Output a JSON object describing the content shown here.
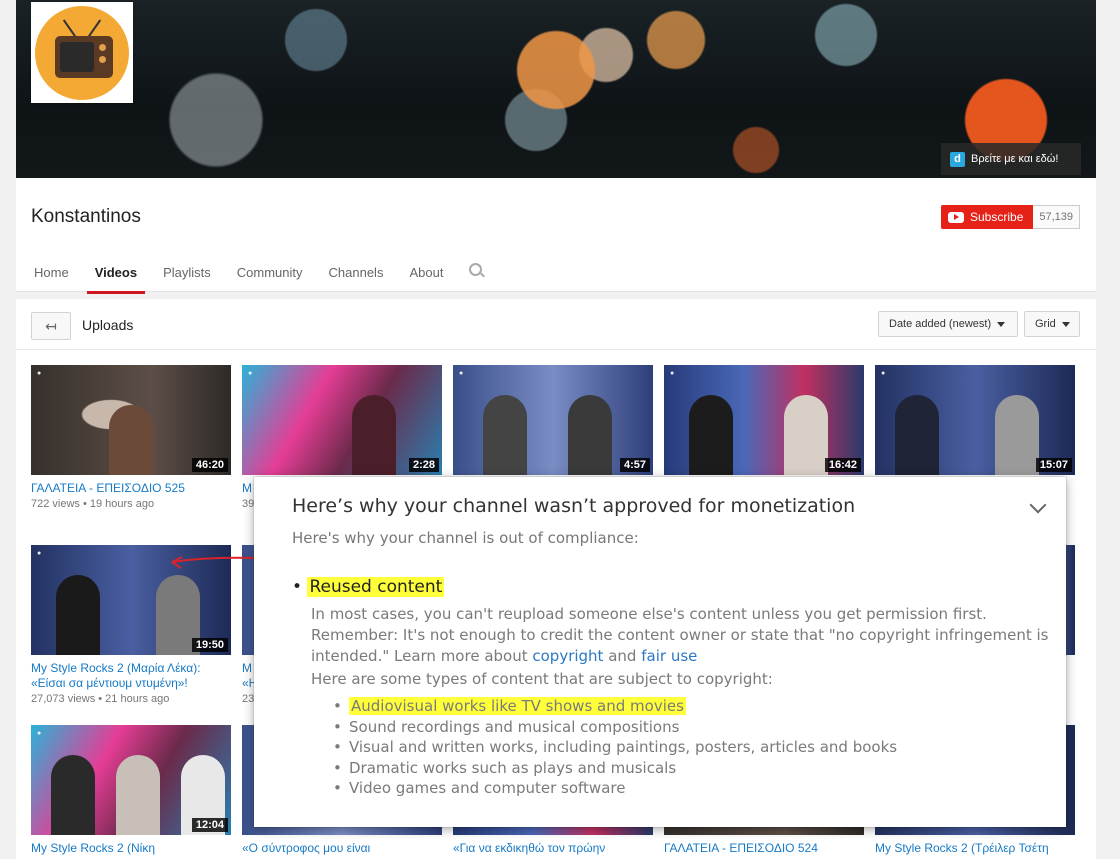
{
  "channel": {
    "name": "Konstantinos",
    "promo_text": "Βρείτε με και εδώ!",
    "subscribe_label": "Subscribe",
    "subscriber_count": "57,139"
  },
  "tabs": [
    "Home",
    "Videos",
    "Playlists",
    "Community",
    "Channels",
    "About"
  ],
  "active_tab": "Videos",
  "uploads": {
    "title": "Uploads",
    "sort_label": "Date added (newest)",
    "view_label": "Grid"
  },
  "videos": [
    {
      "title": "ΓΑΛΑΤΕΙΑ - ΕΠΕΙΣΟΔΙΟ 525",
      "meta": "722 views • 19 hours ago",
      "duration": "46:20"
    },
    {
      "title": "M",
      "meta": "39",
      "duration": "2:28"
    },
    {
      "title": "",
      "meta": "",
      "duration": "4:57"
    },
    {
      "title": "",
      "meta": "",
      "duration": "16:42"
    },
    {
      "title": "",
      "meta": "",
      "duration": "15:07"
    },
    {
      "title": "My Style Rocks 2 (Μαρία Λέκα):",
      "title2": "«Είσαι σα μέντιουμ ντυμένη»!",
      "meta": "27,073 views • 21 hours ago",
      "duration": "19:50"
    },
    {
      "title": "M",
      "title2": "«Η",
      "meta": "23"
    },
    {
      "title": "My Style Rocks 2 (Νίκη",
      "duration": "12:04"
    },
    {
      "title": "«Ο σύντροφος μου είναι"
    },
    {
      "title": "«Για να εκδικηθώ τον πρώην"
    },
    {
      "title": "ΓΑΛΑΤΕΙΑ - ΕΠΕΙΣΟΔΙΟ 524"
    },
    {
      "title": "My Style Rocks 2 (Τρέιλερ Τσέτη"
    }
  ],
  "popup": {
    "title": "Here’s why your channel wasn’t approved for monetization",
    "subtitle": "Here's why your channel is out of compliance:",
    "reason": "Reused content",
    "body_text": "In most cases, you can't reupload someone else's content unless you get permission first. Remember: It's not enough to credit the content owner or state that \"no copyright infringement is intended.\" Learn more about",
    "link_copyright": "copyright",
    "and_text": "and",
    "link_fair_use": "fair use",
    "types_intro": "Here are some types of content that are subject to copyright:",
    "types": [
      "Audiovisual works like TV shows and movies",
      "Sound recordings and musical compositions",
      "Visual and written works, including paintings, posters, articles and books",
      "Dramatic works such as plays and musicals",
      "Video games and computer software"
    ]
  },
  "colors": {
    "accent": "#e62117",
    "link": "#167ac6",
    "highlight": "#ffff3a"
  }
}
